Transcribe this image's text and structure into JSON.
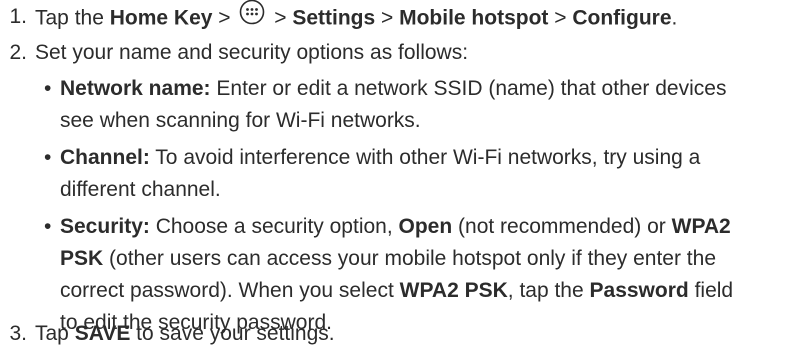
{
  "steps": [
    {
      "number": "1.",
      "text_tap": "Tap the ",
      "home_key": "Home Key",
      "sep1": " > ",
      "apps_icon": "apps-grid-icon",
      "sep2": " > ",
      "settings": "Settings",
      "sep3": " > ",
      "mobile_hotspot": "Mobile hotspot",
      "sep4": " > ",
      "configure": "Configure",
      "end": "."
    },
    {
      "number": "2.",
      "text": "Set your name and security options as follows:"
    },
    {
      "number": "3.",
      "text_tap": "Tap ",
      "save": "SAVE",
      "text_rest": " to save your settings."
    }
  ],
  "bullets": [
    {
      "dot": "•",
      "term": "Network name:",
      "line1": " Enter or edit a network SSID (name) that other devices",
      "line2": "see when scanning for Wi-Fi networks."
    },
    {
      "dot": "•",
      "term": "Channel:",
      "line1": " To avoid interference with other Wi-Fi networks, try using a",
      "line2": "different channel."
    },
    {
      "dot": "•",
      "term": "Security:",
      "t1": " Choose a security option, ",
      "open": "Open",
      "t2": " (not recommended) or ",
      "wpa_line1": "WPA2",
      "wpa_line2": "PSK",
      "t3": " (other users can access your mobile hotspot only if they enter the",
      "t4": "correct password). When you select ",
      "wpa2psk": "WPA2 PSK",
      "t5": ", tap the ",
      "password": "Password",
      "t6": " field",
      "t7": "to edit the security password."
    }
  ]
}
